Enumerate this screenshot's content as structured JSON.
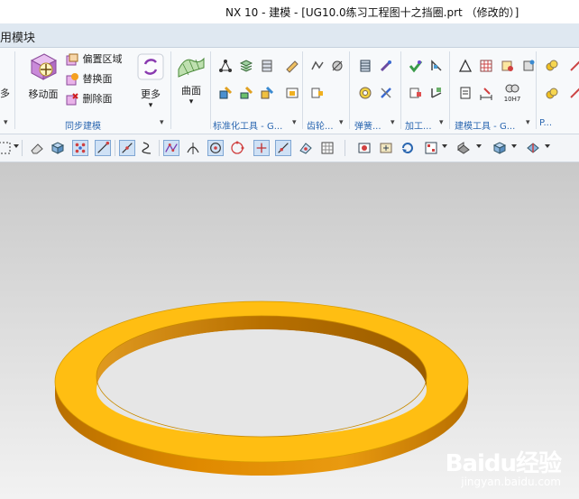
{
  "window": {
    "title": "NX 10 - 建模 - [UG10.0练习工程图十之挡圈.prt （修改的）]"
  },
  "tabbar": {
    "label": "用模块"
  },
  "ribbon": {
    "left_partial": "多",
    "move_face": "移动面",
    "offset_region": "偏置区域",
    "replace_face": "替换面",
    "delete_face": "删除面",
    "more": "更多",
    "surface": "曲面",
    "groups": {
      "sync": "同步建模",
      "standard": "标准化工具 - G...",
      "gear": "齿轮...",
      "spring": "弹簧...",
      "machining": "加工...",
      "modeling": "建模工具 - G...",
      "partial": "P..."
    },
    "tool_10h7": "10H7"
  },
  "watermark": {
    "logo": "Baidu经验",
    "url": "jingyan.baidu.com"
  },
  "colors": {
    "ring_top": "#ffbe12",
    "ring_side": "#e08a00",
    "ring_inner": "#c87800",
    "tab_bg": "#dfe8f1",
    "group_label": "#2a66b0"
  }
}
